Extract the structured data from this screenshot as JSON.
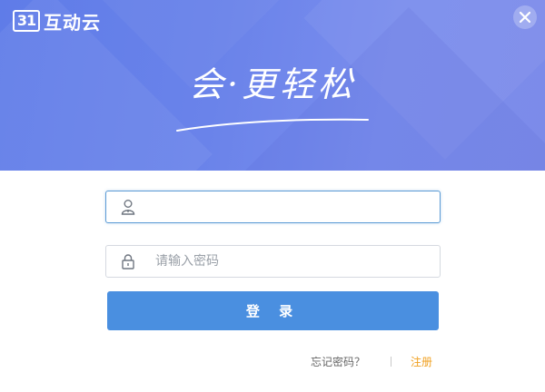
{
  "brand": {
    "mark": "31",
    "name": "互动云"
  },
  "banner": {
    "slogan": "会·更轻松"
  },
  "form": {
    "username": {
      "value": "",
      "placeholder": ""
    },
    "password": {
      "value": "",
      "placeholder": "请输入密码"
    },
    "login_label": "登 录"
  },
  "links": {
    "forgot": "忘记密码？",
    "register": "注册"
  },
  "colors": {
    "banner": "#6a83ea",
    "button": "#4a8fe0",
    "register": "#f0a020",
    "focus_border": "#5b9bd5"
  },
  "icons": {
    "user": "user-icon",
    "lock": "lock-icon",
    "close": "close-icon"
  }
}
